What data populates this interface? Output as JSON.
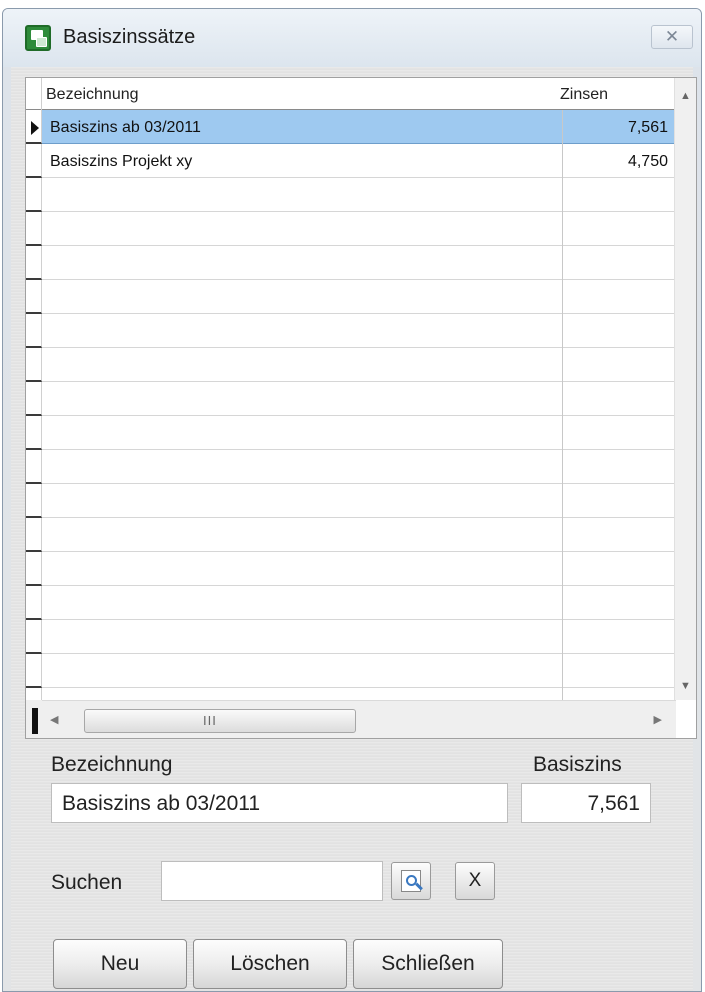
{
  "window": {
    "title": "Basiszinssätze",
    "close_glyph": "✕"
  },
  "grid": {
    "columns": [
      "Bezeichnung",
      "Zinsen"
    ],
    "rows": [
      {
        "name": "Basiszins ab 03/2011",
        "zinsen": "7,561",
        "selected": true
      },
      {
        "name": "Basiszins Projekt xy",
        "zinsen": "4,750",
        "selected": false
      }
    ],
    "scroll_grip": "III"
  },
  "form": {
    "bezeichnung_label": "Bezeichnung",
    "bezeichnung_value": "Basiszins ab 03/2011",
    "basiszins_label": "Basiszins",
    "basiszins_value": "7,561",
    "suchen_label": "Suchen",
    "suchen_value": "",
    "clear_label": "X"
  },
  "buttons": {
    "neu": "Neu",
    "loeschen": "Löschen",
    "schliessen": "Schließen"
  },
  "icons": {
    "app": "app-window-icon",
    "search": "magnifier-icon"
  }
}
